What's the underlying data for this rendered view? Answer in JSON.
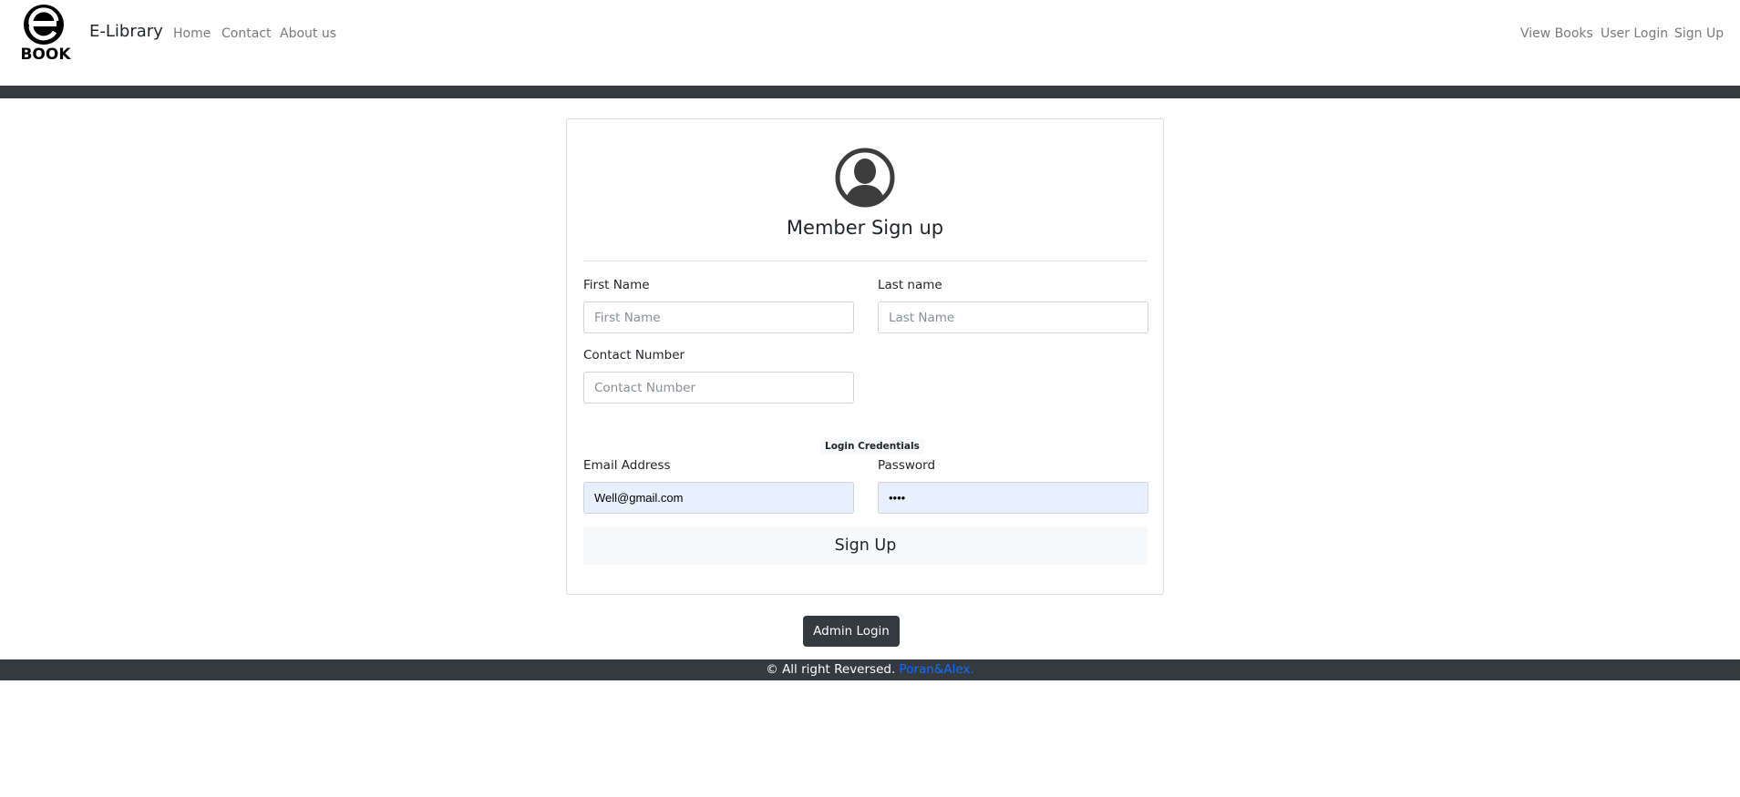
{
  "navbar": {
    "logo_text": "BOOK",
    "brand": "E-Library",
    "left_links": [
      "Home",
      "Contact",
      "About us"
    ],
    "right_links": [
      "View Books",
      "User Login",
      "Sign Up"
    ]
  },
  "form": {
    "title": "Member Sign up",
    "avatar_icon": "user-circle-icon",
    "first_name": {
      "label": "First Name",
      "placeholder": "First Name",
      "value": ""
    },
    "last_name": {
      "label": "Last name",
      "placeholder": "Last Name",
      "value": ""
    },
    "contact": {
      "label": "Contact Number",
      "placeholder": "Contact Number",
      "value": ""
    },
    "credentials_badge": "Login Credentials",
    "email": {
      "label": "Email Address",
      "value": "Well@gmail.com"
    },
    "password": {
      "label": "Password",
      "value": "••••"
    },
    "submit_label": "Sign Up"
  },
  "admin_button": "Admin Login",
  "footer": {
    "text": "© All right Reversed.",
    "link": "Poran&Alex."
  },
  "colors": {
    "dark": "#343a40",
    "link": "#0d6efd",
    "autofill": "#e8f0fe"
  }
}
